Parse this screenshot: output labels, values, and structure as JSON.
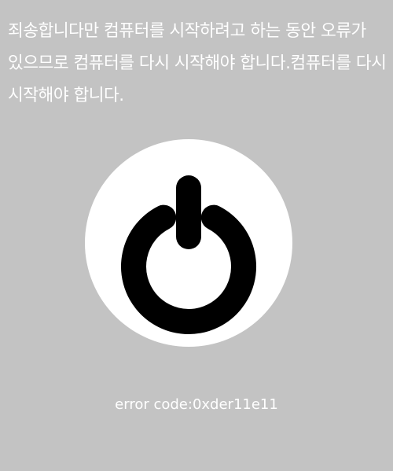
{
  "message": "죄송합니다만 컴퓨터를 시작하려고 하는 동안 오류가 있으므로 컴퓨터를 다시 시작해야 합니다.컴퓨터를 다시 시작해야 합니다.",
  "power_icon": {
    "icon": "power-icon",
    "circle_color": "#ffffff",
    "symbol_color": "#000000"
  },
  "error": {
    "label": "error code:",
    "value": "0xder11e11"
  },
  "colors": {
    "background": "#c3c3c3",
    "text": "#ffffff"
  }
}
